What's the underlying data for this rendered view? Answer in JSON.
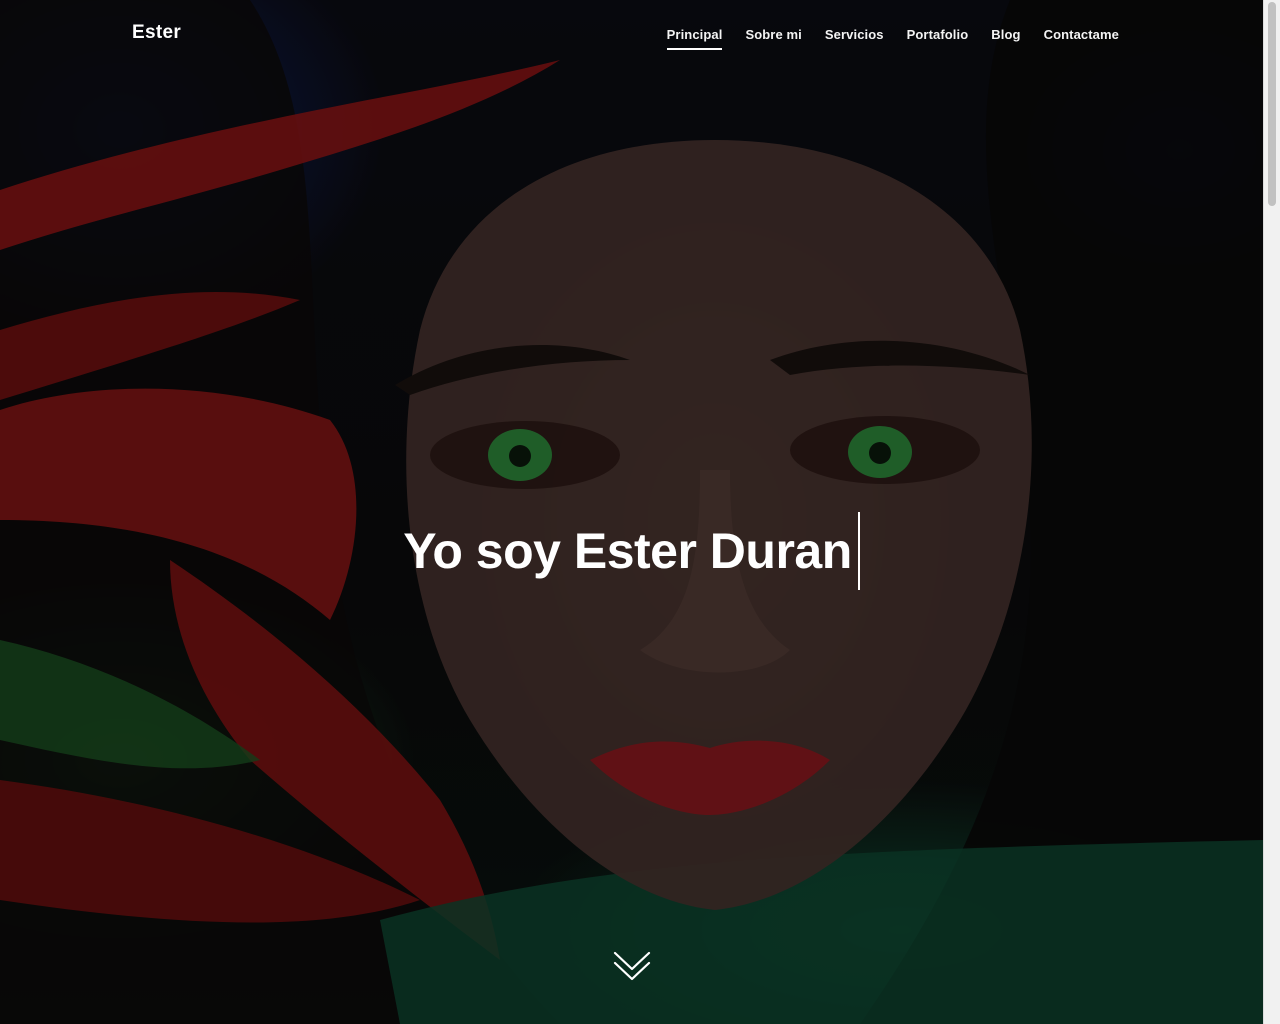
{
  "site": {
    "logo": "Ester"
  },
  "nav": {
    "items": [
      {
        "label": "Principal",
        "active": true
      },
      {
        "label": "Sobre mi"
      },
      {
        "label": "Servicios"
      },
      {
        "label": "Portafolio"
      },
      {
        "label": "Blog"
      },
      {
        "label": "Contactame"
      }
    ]
  },
  "hero": {
    "headline": "Yo soy Ester Duran",
    "background_image": "portrait-woman-green-eyes-red-hair",
    "scroll_icon": "double-chevron-down-icon"
  },
  "colors": {
    "text": "#ffffff",
    "overlay": "#000000",
    "hair_red": "#b51414",
    "eyes_green": "#2f8a3c",
    "lips": "#8e1a1f"
  }
}
